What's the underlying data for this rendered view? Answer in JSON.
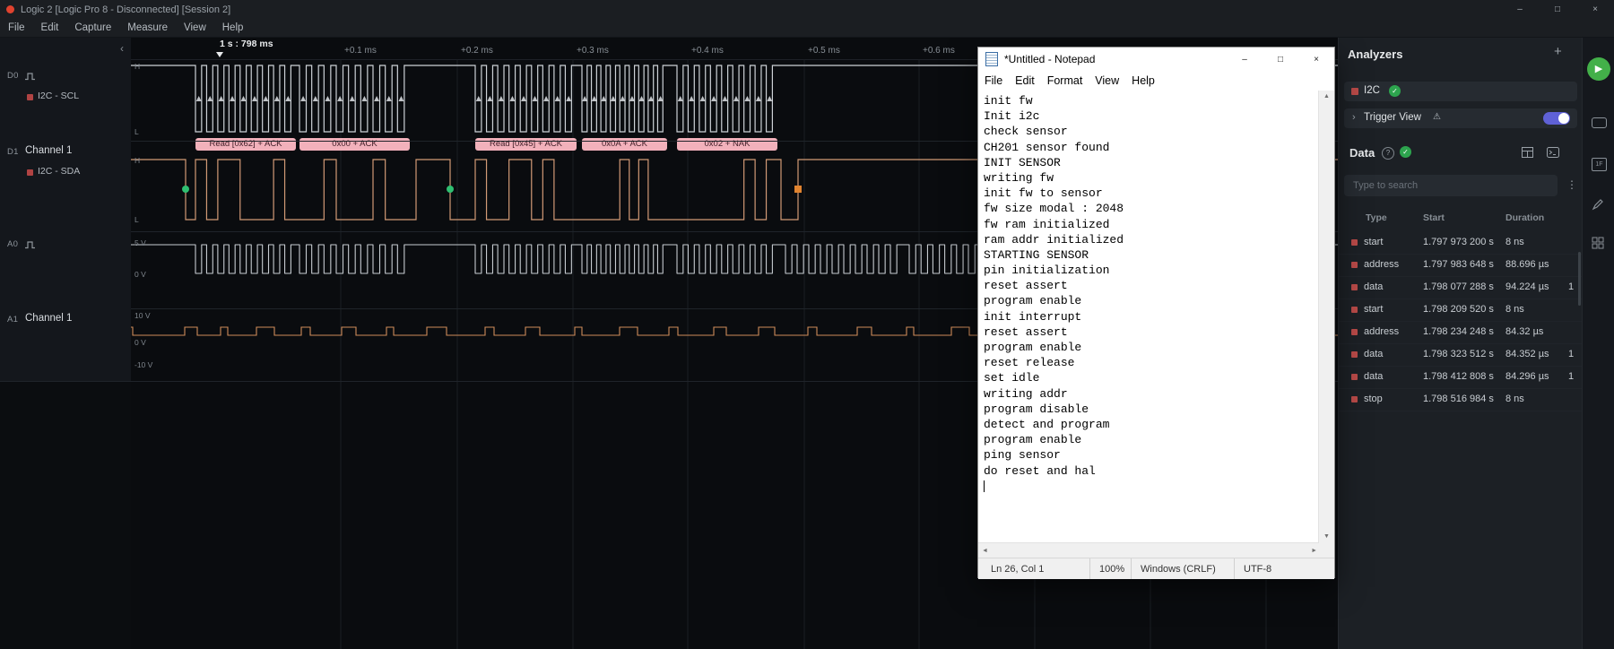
{
  "app": {
    "title": "Logic 2 [Logic Pro 8 - Disconnected] [Session 2]"
  },
  "menu": {
    "items": [
      "File",
      "Edit",
      "Capture",
      "Measure",
      "View",
      "Help"
    ]
  },
  "timeline": {
    "anchor": "1 s : 798 ms",
    "ticks": [
      "+0.1 ms",
      "+0.2 ms",
      "+0.3 ms",
      "+0.4 ms",
      "+0.5 ms",
      "+0.6 ms"
    ]
  },
  "channels": {
    "d0": {
      "id": "D0",
      "analyzer": "I2C - SCL",
      "hi": "H",
      "lo": "L"
    },
    "d1": {
      "id": "D1",
      "name": "Channel 1",
      "analyzer": "I2C - SDA",
      "hi": "H",
      "lo": "L"
    },
    "a0": {
      "id": "A0",
      "labels": [
        "5 V",
        "0 V"
      ]
    },
    "a1": {
      "id": "A1",
      "name": "Channel 1",
      "labels": [
        "10 V",
        "0 V",
        "-10 V"
      ]
    }
  },
  "decoder_bubbles": [
    "Read [0x62] + ACK",
    "0x00 + ACK",
    "Read [0x45] + ACK",
    "0x0A + ACK",
    "0x02 + NAK"
  ],
  "analyzers": {
    "title": "Analyzers",
    "add_label": "+",
    "i2c": "I2C",
    "trigger_view": "Trigger View",
    "trigger_view_enabled": true,
    "data": {
      "title": "Data",
      "search_placeholder": "Type to search",
      "headers": [
        "Type",
        "Start",
        "Duration"
      ],
      "rows": [
        {
          "type": "start",
          "start": "1.797 973 200 s",
          "duration": "8 ns",
          "extra": ""
        },
        {
          "type": "address",
          "start": "1.797 983 648 s",
          "duration": "88.696 µs",
          "extra": ""
        },
        {
          "type": "data",
          "start": "1.798 077 288 s",
          "duration": "94.224 µs",
          "extra": "1"
        },
        {
          "type": "start",
          "start": "1.798 209 520 s",
          "duration": "8 ns",
          "extra": ""
        },
        {
          "type": "address",
          "start": "1.798 234 248 s",
          "duration": "84.32 µs",
          "extra": ""
        },
        {
          "type": "data",
          "start": "1.798 323 512 s",
          "duration": "84.352 µs",
          "extra": "1"
        },
        {
          "type": "data",
          "start": "1.798 412 808 s",
          "duration": "84.296 µs",
          "extra": "1"
        },
        {
          "type": "stop",
          "start": "1.798 516 984 s",
          "duration": "8 ns",
          "extra": ""
        }
      ]
    }
  },
  "notepad": {
    "title": "*Untitled - Notepad",
    "menu": [
      "File",
      "Edit",
      "Format",
      "View",
      "Help"
    ],
    "lines": [
      "init fw",
      "Init i2c",
      "check sensor",
      "CH201 sensor found",
      "INIT SENSOR",
      "writing fw",
      "init fw to sensor",
      "fw size modal : 2048",
      "fw ram initialized",
      "ram addr initialized",
      "STARTING SENSOR",
      "pin initialization",
      "reset assert",
      "program enable",
      "init interrupt",
      "reset assert",
      "program enable",
      "reset release",
      "set idle",
      "writing addr",
      "program disable",
      "detect and program",
      "program enable",
      "ping sensor",
      "do reset and hal"
    ],
    "status": {
      "cursor": "Ln 26, Col 1",
      "zoom": "100%",
      "eol": "Windows (CRLF)",
      "encoding": "UTF-8"
    }
  },
  "colors": {
    "bubble_pink": "#f2b1bb",
    "d0_gray": "#cdd2d7",
    "d1_orange": "#d29a76",
    "a1_orange": "#cf8c5a",
    "accent_green": "#2da44e",
    "play_green": "#43b049",
    "toggle_purple": "#5f61d6",
    "channel_red": "#b04343",
    "marker_green": "#2fbf71",
    "marker_orange": "#e0832f"
  }
}
